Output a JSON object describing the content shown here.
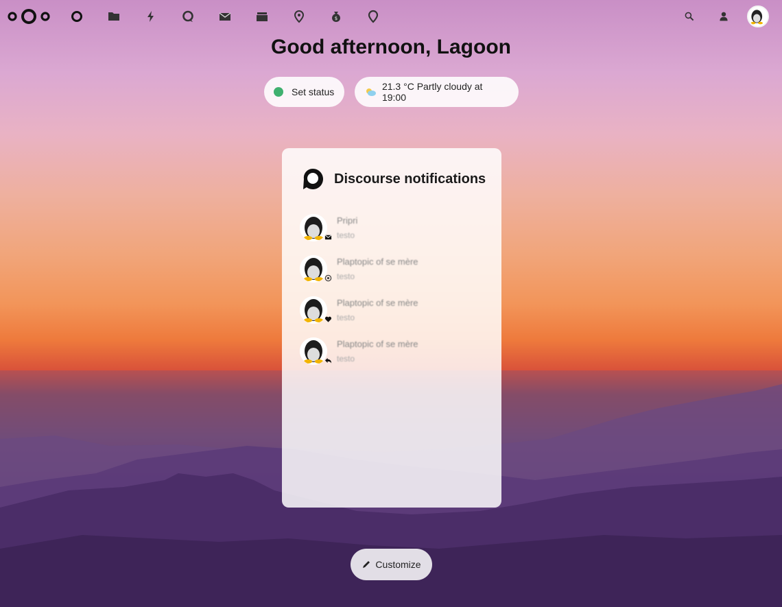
{
  "header": {
    "apps": [
      {
        "name": "dashboard-icon"
      },
      {
        "name": "files-icon"
      },
      {
        "name": "activity-icon"
      },
      {
        "name": "talk-icon"
      },
      {
        "name": "mail-icon"
      },
      {
        "name": "deck-icon"
      },
      {
        "name": "maps-icon"
      },
      {
        "name": "money-icon"
      },
      {
        "name": "location-icon"
      }
    ],
    "right": [
      {
        "name": "search-icon"
      },
      {
        "name": "contacts-icon"
      }
    ]
  },
  "greeting": "Good afternoon, Lagoon",
  "status": {
    "label": "Set status",
    "color": "#3fb06f"
  },
  "weather": {
    "label": "21.3 °C Partly cloudy at 19:00"
  },
  "widget": {
    "title": "Discourse notifications",
    "items": [
      {
        "title": "Pripri",
        "subtitle": "testo",
        "badge": "envelope-icon"
      },
      {
        "title": "Plaptopic of se mère",
        "subtitle": "testo",
        "badge": "at-icon"
      },
      {
        "title": "Plaptopic of se mère",
        "subtitle": "testo",
        "badge": "heart-icon"
      },
      {
        "title": "Plaptopic of se mère",
        "subtitle": "testo",
        "badge": "reply-icon"
      }
    ]
  },
  "customize": {
    "label": "Customize"
  }
}
